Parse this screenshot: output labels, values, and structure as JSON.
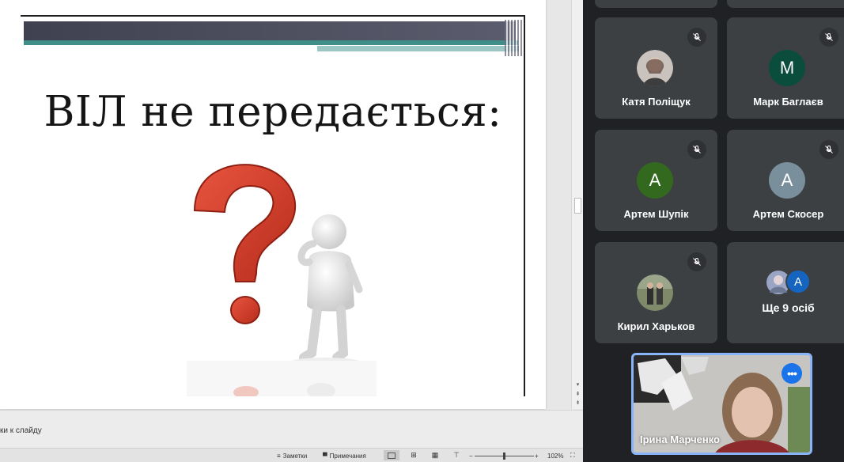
{
  "slide": {
    "title": "ВІЛ не передається:"
  },
  "notes": {
    "placeholder": "ки к слайду"
  },
  "statusbar": {
    "notes_label": "Заметки",
    "comments_label": "Примечания",
    "zoom": "102%"
  },
  "meet": {
    "tiles": [
      {
        "name": "Катя Поліщук",
        "avatar": "photo",
        "muted": true
      },
      {
        "name": "Марк Баглаєв",
        "initial": "М",
        "color": "#0b4d3d",
        "muted": true
      },
      {
        "name": "Артем Шупік",
        "initial": "А",
        "color": "#33691e",
        "muted": true
      },
      {
        "name": "Артем Скосер",
        "initial": "А",
        "color": "#7a8f9c",
        "muted": true
      },
      {
        "name": "Кирил Харьков",
        "avatar": "photo",
        "muted": true
      },
      {
        "name": "Ще 9 осіб",
        "initial": "A",
        "color": "#1565c0"
      }
    ],
    "self": {
      "name": "Ірина Марченко",
      "more_icon": "more-horizontal-icon"
    },
    "icons": {
      "mute": "mic-off-icon"
    }
  },
  "colors": {
    "meet_bg": "#202124",
    "tile_bg": "#3c4043",
    "self_border": "#8ab4f8",
    "accent_blue": "#1a73e8"
  }
}
